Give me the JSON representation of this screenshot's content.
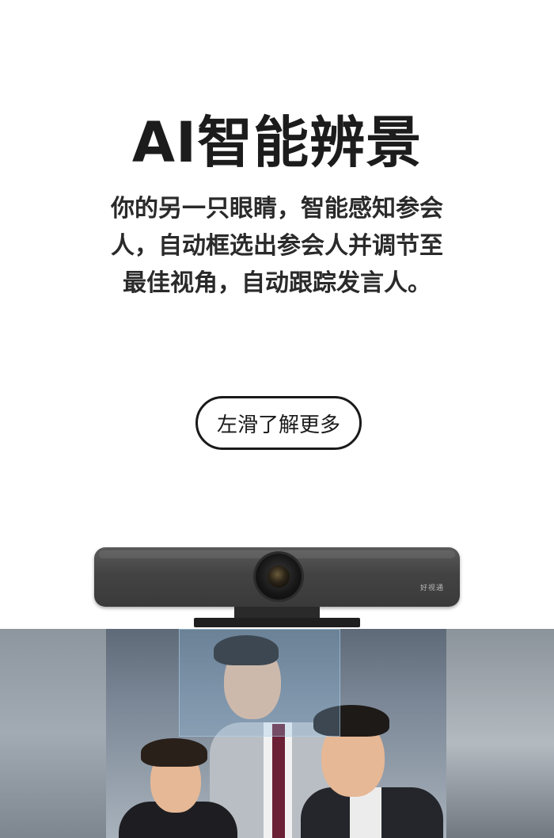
{
  "title": "AI智能辨景",
  "description_lines": [
    "你的另一只眼睛，智能感知参会",
    "人，自动框选出参会人并调节至",
    "最佳视角，自动跟踪发言人。"
  ],
  "more_button": "左滑了解更多",
  "device_brand": "好视通"
}
